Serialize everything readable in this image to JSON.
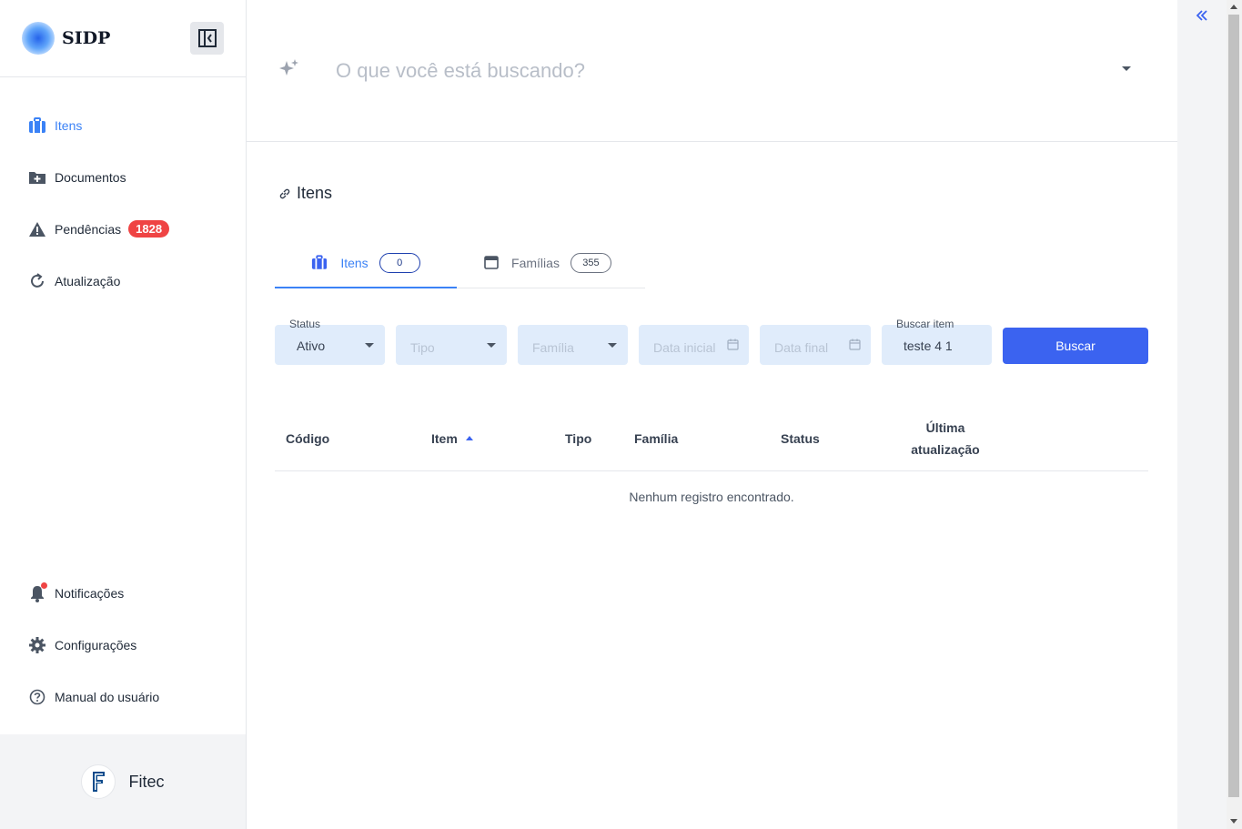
{
  "app": {
    "name": "SIDP"
  },
  "sidebar": {
    "items": [
      {
        "label": "Itens",
        "icon": "luggage-icon",
        "active": true
      },
      {
        "label": "Documentos",
        "icon": "folder-plus-icon"
      },
      {
        "label": "Pendências",
        "icon": "warning-icon",
        "badge": "1828"
      },
      {
        "label": "Atualização",
        "icon": "refresh-icon"
      }
    ],
    "bottom_items": [
      {
        "label": "Notificações",
        "icon": "bell-icon"
      },
      {
        "label": "Configurações",
        "icon": "gear-icon"
      },
      {
        "label": "Manual do usuário",
        "icon": "help-circle-icon"
      }
    ],
    "footer": {
      "org": "Fitec"
    }
  },
  "search": {
    "placeholder": "O que você está buscando?"
  },
  "page": {
    "title": "Itens"
  },
  "tabs": [
    {
      "label": "Itens",
      "count": "0",
      "icon": "luggage-icon"
    },
    {
      "label": "Famílias",
      "count": "355",
      "icon": "window-icon"
    }
  ],
  "filters": {
    "status": {
      "label": "Status",
      "value": "Ativo"
    },
    "tipo": {
      "placeholder": "Tipo"
    },
    "familia": {
      "placeholder": "Família"
    },
    "data_inicial": {
      "placeholder": "Data inicial"
    },
    "data_final": {
      "placeholder": "Data final"
    },
    "buscar_item": {
      "label": "Buscar item",
      "value": "teste 4 1"
    },
    "button": "Buscar"
  },
  "table": {
    "columns": [
      "Código",
      "Item",
      "Tipo",
      "Família",
      "Status",
      "Última atualização"
    ],
    "empty": "Nenhum registro encontrado."
  },
  "colors": {
    "accent": "#3b63f0",
    "badge": "#ef4444",
    "filter_bg": "#e0ecfb"
  }
}
